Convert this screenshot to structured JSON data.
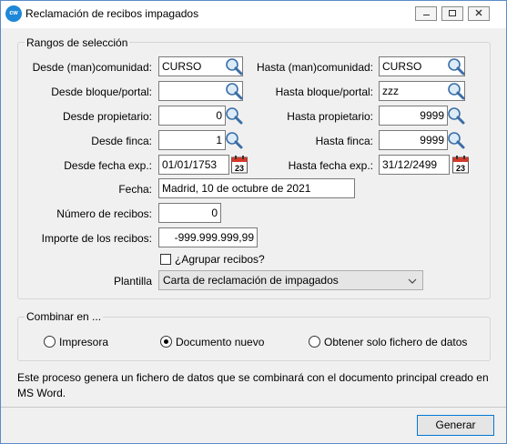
{
  "window": {
    "title": "Reclamación de recibos impagados",
    "app_icon": "cw"
  },
  "ranges": {
    "legend": "Rangos de selección",
    "from_community_label": "Desde (man)comunidad:",
    "from_community_value": "CURSO",
    "to_community_label": "Hasta (man)comunidad:",
    "to_community_value": "CURSO",
    "from_block_label": "Desde bloque/portal:",
    "from_block_value": "",
    "to_block_label": "Hasta bloque/portal:",
    "to_block_value": "zzz",
    "from_owner_label": "Desde propietario:",
    "from_owner_value": "0",
    "to_owner_label": "Hasta propietario:",
    "to_owner_value": "9999",
    "from_property_label": "Desde finca:",
    "from_property_value": "1",
    "to_property_label": "Hasta finca:",
    "to_property_value": "9999",
    "from_date_label": "Desde fecha exp.:",
    "from_date_value": "01/01/1753",
    "to_date_label": "Hasta fecha exp.:",
    "to_date_value": "31/12/2499",
    "calendar_day": "23",
    "date_label": "Fecha:",
    "date_value": "Madrid, 10 de octubre de 2021",
    "receipts_label": "Número de recibos:",
    "receipts_value": "0",
    "amount_label": "Importe de los recibos:",
    "amount_value": "-999.999.999,99",
    "group_label": "¿Agrupar recibos?",
    "group_checked": false,
    "template_label": "Plantilla",
    "template_value": "Carta de reclamación de impagados"
  },
  "combine": {
    "legend": "Combinar en ...",
    "options": [
      "Impresora",
      "Documento nuevo",
      "Obtener solo fichero de datos"
    ],
    "selected": "Documento nuevo"
  },
  "note": "Este proceso genera un fichero de datos que se combinará con el documento principal creado en MS Word.",
  "generate_label": "Generar"
}
